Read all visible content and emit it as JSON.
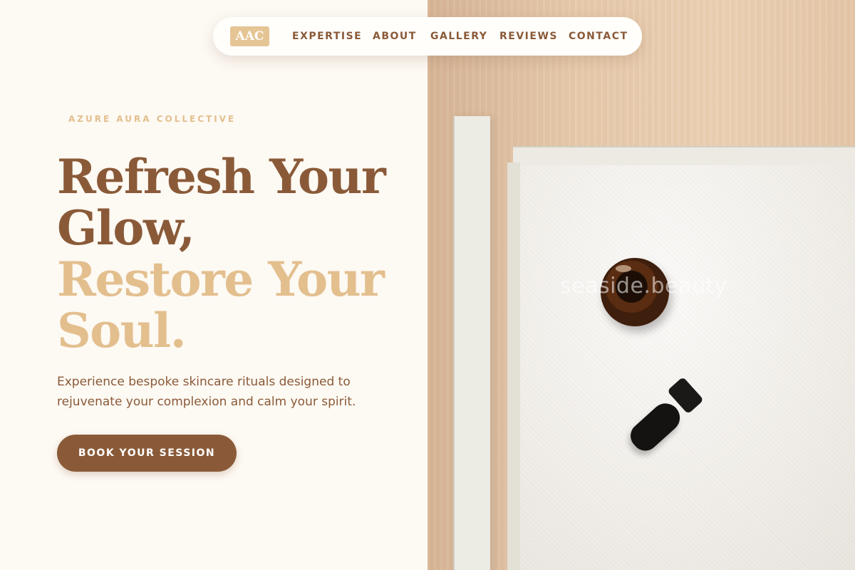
{
  "nav": {
    "logo": "AAC",
    "links": [
      "EXPERTISE",
      "ABOUT",
      "GALLERY",
      "REVIEWS",
      "CONTACT"
    ]
  },
  "hero": {
    "eyebrow": "AZURE AURA COLLECTIVE",
    "headline_line1": "Refresh Your Glow,",
    "headline_line2": "Restore Your Soul.",
    "subtitle": "Experience bespoke skincare rituals designed to rejuvenate your complexion and calm your spirit.",
    "cta_label": "BOOK YOUR SESSION"
  },
  "image": {
    "watermark": "seaside.beauty"
  },
  "colors": {
    "brand_brown": "#8a5a38",
    "accent_gold": "#e3bf8e",
    "background": "#fdf9f3"
  }
}
